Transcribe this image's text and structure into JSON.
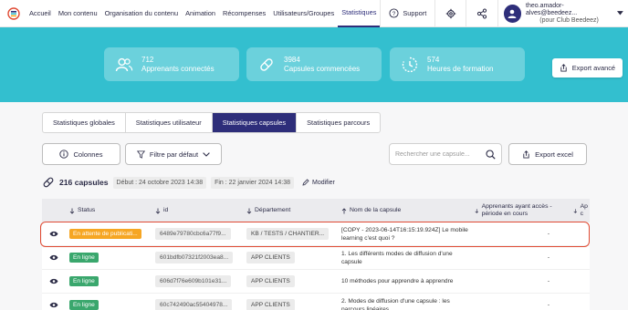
{
  "nav": {
    "items": [
      "Accueil",
      "Mon contenu",
      "Organisation du contenu",
      "Animation",
      "Récompenses",
      "Utilisateurs/Groupes",
      "Statistiques"
    ],
    "support_label": "Support",
    "user_email": "theo.amador-alves@beedeez...",
    "user_org": "(pour Club Beedeez)"
  },
  "banner": {
    "stats": [
      {
        "value": "712",
        "label": "Apprenants connectés",
        "icon": "users-icon"
      },
      {
        "value": "3984",
        "label": "Capsules commencées",
        "icon": "capsule-icon"
      },
      {
        "value": "574",
        "label": "Heures de formation",
        "icon": "clock-icon"
      }
    ],
    "export_label": "Export avancé"
  },
  "tabs": [
    "Statistiques globales",
    "Statistiques utilisateur",
    "Statistiques capsules",
    "Statistiques parcours"
  ],
  "toolbar": {
    "columns_label": "Colonnes",
    "filter_label": "Filtre par défaut",
    "search_placeholder": "Rechercher une capsule...",
    "export_label": "Export excel"
  },
  "summary": {
    "count": "216 capsules",
    "start": "Début : 24 octobre 2023 14:38",
    "end": "Fin : 22 janvier 2024 14:38",
    "modify_label": "Modifier"
  },
  "table": {
    "headers": [
      "Status",
      "id",
      "Département",
      "Nom de la capsule",
      "Apprenants ayant accès - période en cours",
      "Ap c"
    ],
    "rows": [
      {
        "status": "En attente de publicati...",
        "status_color": "#f6a623",
        "id": "6489e79780cbc6a77f9...",
        "dept": "KB / TESTS / CHANTIER...",
        "name": "[COPY - 2023-06-14T16:15:19.924Z] Le mobile learning c'est quoi ?",
        "access": "-"
      },
      {
        "status": "En ligne",
        "status_color": "#3aa76d",
        "id": "601bdfb07321f2003ea8...",
        "dept": "APP CLIENTS",
        "name": "1. Les différents modes de diffusion d'une capsule",
        "access": "-"
      },
      {
        "status": "En ligne",
        "status_color": "#3aa76d",
        "id": "606d7f76e609b101e31...",
        "dept": "APP CLIENTS",
        "name": "10 méthodes pour apprendre à apprendre",
        "access": "-"
      },
      {
        "status": "En ligne",
        "status_color": "#3aa76d",
        "id": "60c742490ac55404978...",
        "dept": "APP CLIENTS",
        "name": "2. Modes de diffusion d'une capsule : les parcours linéaires",
        "access": "-"
      }
    ]
  },
  "colors": {
    "accent": "#2e2e7a",
    "banner": "#33bfcf",
    "highlight": "#e04a33"
  }
}
